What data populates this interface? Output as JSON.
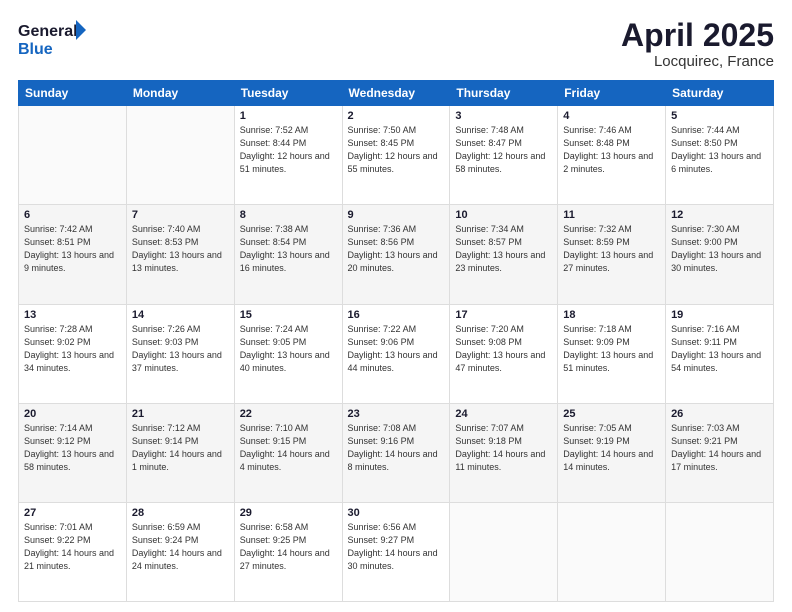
{
  "header": {
    "logo_line1": "General",
    "logo_line2": "Blue",
    "title": "April 2025",
    "subtitle": "Locquirec, France"
  },
  "days_of_week": [
    "Sunday",
    "Monday",
    "Tuesday",
    "Wednesday",
    "Thursday",
    "Friday",
    "Saturday"
  ],
  "weeks": [
    [
      {
        "num": "",
        "info": ""
      },
      {
        "num": "",
        "info": ""
      },
      {
        "num": "1",
        "info": "Sunrise: 7:52 AM\nSunset: 8:44 PM\nDaylight: 12 hours and 51 minutes."
      },
      {
        "num": "2",
        "info": "Sunrise: 7:50 AM\nSunset: 8:45 PM\nDaylight: 12 hours and 55 minutes."
      },
      {
        "num": "3",
        "info": "Sunrise: 7:48 AM\nSunset: 8:47 PM\nDaylight: 12 hours and 58 minutes."
      },
      {
        "num": "4",
        "info": "Sunrise: 7:46 AM\nSunset: 8:48 PM\nDaylight: 13 hours and 2 minutes."
      },
      {
        "num": "5",
        "info": "Sunrise: 7:44 AM\nSunset: 8:50 PM\nDaylight: 13 hours and 6 minutes."
      }
    ],
    [
      {
        "num": "6",
        "info": "Sunrise: 7:42 AM\nSunset: 8:51 PM\nDaylight: 13 hours and 9 minutes."
      },
      {
        "num": "7",
        "info": "Sunrise: 7:40 AM\nSunset: 8:53 PM\nDaylight: 13 hours and 13 minutes."
      },
      {
        "num": "8",
        "info": "Sunrise: 7:38 AM\nSunset: 8:54 PM\nDaylight: 13 hours and 16 minutes."
      },
      {
        "num": "9",
        "info": "Sunrise: 7:36 AM\nSunset: 8:56 PM\nDaylight: 13 hours and 20 minutes."
      },
      {
        "num": "10",
        "info": "Sunrise: 7:34 AM\nSunset: 8:57 PM\nDaylight: 13 hours and 23 minutes."
      },
      {
        "num": "11",
        "info": "Sunrise: 7:32 AM\nSunset: 8:59 PM\nDaylight: 13 hours and 27 minutes."
      },
      {
        "num": "12",
        "info": "Sunrise: 7:30 AM\nSunset: 9:00 PM\nDaylight: 13 hours and 30 minutes."
      }
    ],
    [
      {
        "num": "13",
        "info": "Sunrise: 7:28 AM\nSunset: 9:02 PM\nDaylight: 13 hours and 34 minutes."
      },
      {
        "num": "14",
        "info": "Sunrise: 7:26 AM\nSunset: 9:03 PM\nDaylight: 13 hours and 37 minutes."
      },
      {
        "num": "15",
        "info": "Sunrise: 7:24 AM\nSunset: 9:05 PM\nDaylight: 13 hours and 40 minutes."
      },
      {
        "num": "16",
        "info": "Sunrise: 7:22 AM\nSunset: 9:06 PM\nDaylight: 13 hours and 44 minutes."
      },
      {
        "num": "17",
        "info": "Sunrise: 7:20 AM\nSunset: 9:08 PM\nDaylight: 13 hours and 47 minutes."
      },
      {
        "num": "18",
        "info": "Sunrise: 7:18 AM\nSunset: 9:09 PM\nDaylight: 13 hours and 51 minutes."
      },
      {
        "num": "19",
        "info": "Sunrise: 7:16 AM\nSunset: 9:11 PM\nDaylight: 13 hours and 54 minutes."
      }
    ],
    [
      {
        "num": "20",
        "info": "Sunrise: 7:14 AM\nSunset: 9:12 PM\nDaylight: 13 hours and 58 minutes."
      },
      {
        "num": "21",
        "info": "Sunrise: 7:12 AM\nSunset: 9:14 PM\nDaylight: 14 hours and 1 minute."
      },
      {
        "num": "22",
        "info": "Sunrise: 7:10 AM\nSunset: 9:15 PM\nDaylight: 14 hours and 4 minutes."
      },
      {
        "num": "23",
        "info": "Sunrise: 7:08 AM\nSunset: 9:16 PM\nDaylight: 14 hours and 8 minutes."
      },
      {
        "num": "24",
        "info": "Sunrise: 7:07 AM\nSunset: 9:18 PM\nDaylight: 14 hours and 11 minutes."
      },
      {
        "num": "25",
        "info": "Sunrise: 7:05 AM\nSunset: 9:19 PM\nDaylight: 14 hours and 14 minutes."
      },
      {
        "num": "26",
        "info": "Sunrise: 7:03 AM\nSunset: 9:21 PM\nDaylight: 14 hours and 17 minutes."
      }
    ],
    [
      {
        "num": "27",
        "info": "Sunrise: 7:01 AM\nSunset: 9:22 PM\nDaylight: 14 hours and 21 minutes."
      },
      {
        "num": "28",
        "info": "Sunrise: 6:59 AM\nSunset: 9:24 PM\nDaylight: 14 hours and 24 minutes."
      },
      {
        "num": "29",
        "info": "Sunrise: 6:58 AM\nSunset: 9:25 PM\nDaylight: 14 hours and 27 minutes."
      },
      {
        "num": "30",
        "info": "Sunrise: 6:56 AM\nSunset: 9:27 PM\nDaylight: 14 hours and 30 minutes."
      },
      {
        "num": "",
        "info": ""
      },
      {
        "num": "",
        "info": ""
      },
      {
        "num": "",
        "info": ""
      }
    ]
  ]
}
